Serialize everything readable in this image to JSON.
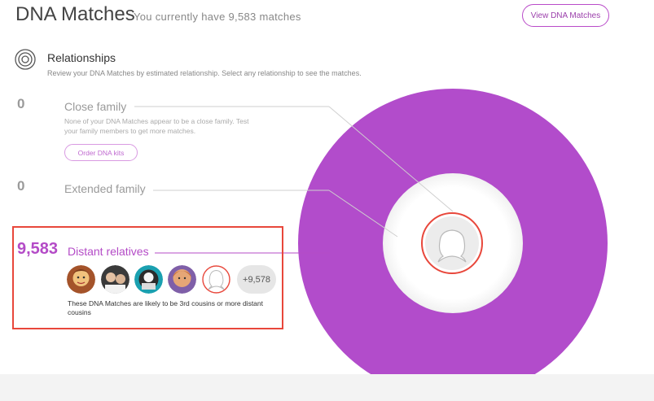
{
  "header": {
    "title": "DNA Matches",
    "subtitle": "You currently have 9,583 matches",
    "view_button": "View DNA Matches"
  },
  "relationships": {
    "title": "Relationships",
    "subtitle": "Review your DNA Matches by estimated relationship. Select any relationship to see the matches."
  },
  "close_family": {
    "count": "0",
    "label": "Close family",
    "desc_line1": "None of your DNA Matches appear to be a close family. Test",
    "desc_line2": "your family members to get more matches.",
    "order_button": "Order DNA kits"
  },
  "extended_family": {
    "count": "0",
    "label": "Extended family"
  },
  "distant_relatives": {
    "count": "9,583",
    "label": "Distant relatives",
    "more_count": "+9,578",
    "desc": "These DNA Matches are likely to be 3rd cousins or more distant cousins"
  },
  "colors": {
    "accent": "#b44bc7",
    "donut": "#b24ccb",
    "highlight_border": "#e8473b"
  }
}
